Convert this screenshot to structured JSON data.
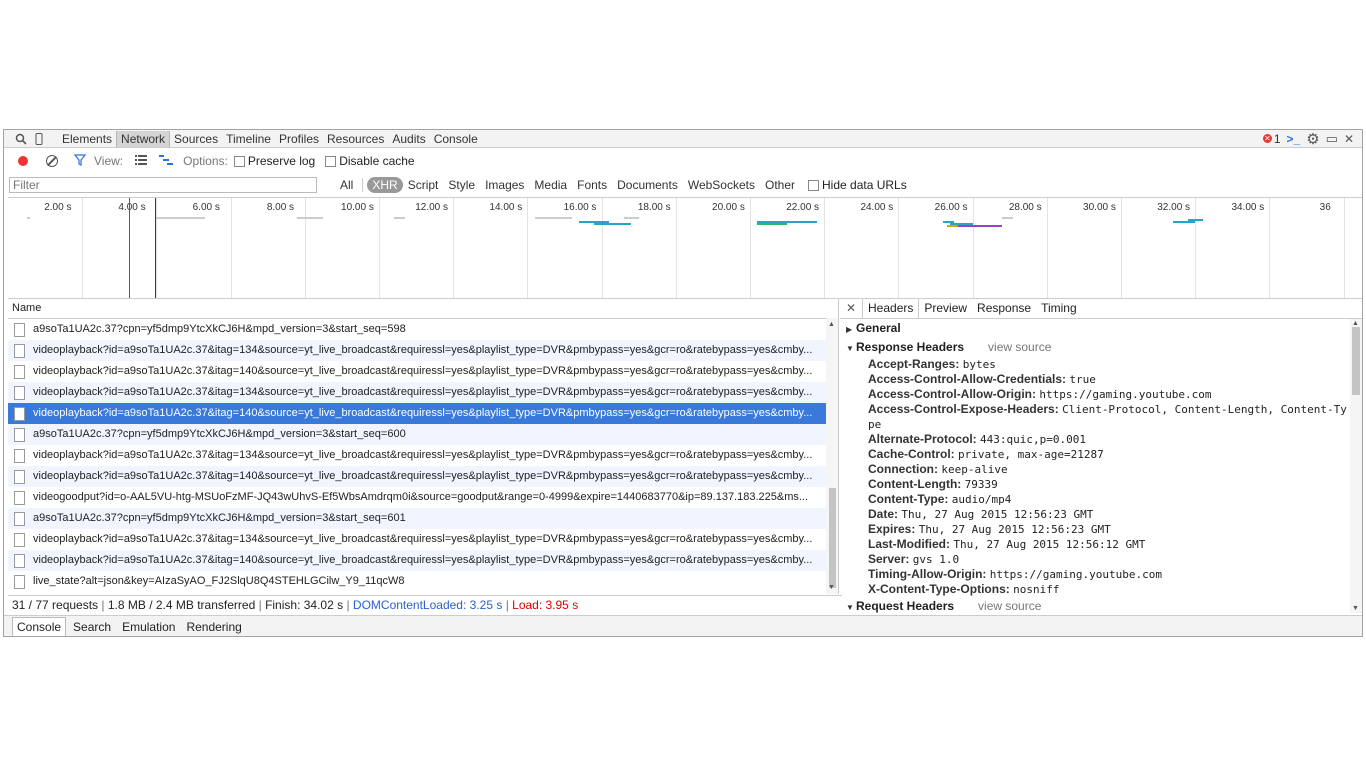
{
  "panels": [
    "Elements",
    "Network",
    "Sources",
    "Timeline",
    "Profiles",
    "Resources",
    "Audits",
    "Console"
  ],
  "selected_panel": "Network",
  "error_count": "1",
  "network_toolbar": {
    "view_label": "View:",
    "options_label": "Options:",
    "preserve_log_label": "Preserve log",
    "disable_cache_label": "Disable cache"
  },
  "filter": {
    "placeholder": "Filter",
    "value": ""
  },
  "type_filters": [
    "All",
    "XHR",
    "Script",
    "Style",
    "Images",
    "Media",
    "Fonts",
    "Documents",
    "WebSockets",
    "Other"
  ],
  "selected_type": "XHR",
  "hide_data_urls_label": "Hide data URLs",
  "overview_ticks": [
    "2.00 s",
    "4.00 s",
    "6.00 s",
    "8.00 s",
    "10.00 s",
    "12.00 s",
    "14.00 s",
    "16.00 s",
    "18.00 s",
    "20.00 s",
    "22.00 s",
    "24.00 s",
    "26.00 s",
    "28.00 s",
    "30.00 s",
    "32.00 s",
    "34.00 s",
    "36"
  ],
  "markers": {
    "dom_content_loaded_s": 3.25,
    "load_s": 3.95,
    "total_s": 36
  },
  "table": {
    "name_header": "Name",
    "requests": [
      "a9soTa1UA2c.37?cpn=yf5dmp9YtcXkCJ6H&mpd_version=3&start_seq=598",
      "videoplayback?id=a9soTa1UA2c.37&itag=134&source=yt_live_broadcast&requiressl=yes&playlist_type=DVR&pmbypass=yes&gcr=ro&ratebypass=yes&cmby...",
      "videoplayback?id=a9soTa1UA2c.37&itag=140&source=yt_live_broadcast&requiressl=yes&playlist_type=DVR&pmbypass=yes&gcr=ro&ratebypass=yes&cmby...",
      "videoplayback?id=a9soTa1UA2c.37&itag=134&source=yt_live_broadcast&requiressl=yes&playlist_type=DVR&pmbypass=yes&gcr=ro&ratebypass=yes&cmby...",
      "videoplayback?id=a9soTa1UA2c.37&itag=140&source=yt_live_broadcast&requiressl=yes&playlist_type=DVR&pmbypass=yes&gcr=ro&ratebypass=yes&cmby...",
      "a9soTa1UA2c.37?cpn=yf5dmp9YtcXkCJ6H&mpd_version=3&start_seq=600",
      "videoplayback?id=a9soTa1UA2c.37&itag=134&source=yt_live_broadcast&requiressl=yes&playlist_type=DVR&pmbypass=yes&gcr=ro&ratebypass=yes&cmby...",
      "videoplayback?id=a9soTa1UA2c.37&itag=140&source=yt_live_broadcast&requiressl=yes&playlist_type=DVR&pmbypass=yes&gcr=ro&ratebypass=yes&cmby...",
      "videogoodput?id=o-AAL5VU-htg-MSUoFzMF-JQ43wUhvS-Ef5WbsAmdrqm0i&source=goodput&range=0-4999&expire=1440683770&ip=89.137.183.225&ms...",
      "a9soTa1UA2c.37?cpn=yf5dmp9YtcXkCJ6H&mpd_version=3&start_seq=601",
      "videoplayback?id=a9soTa1UA2c.37&itag=134&source=yt_live_broadcast&requiressl=yes&playlist_type=DVR&pmbypass=yes&gcr=ro&ratebypass=yes&cmby...",
      "videoplayback?id=a9soTa1UA2c.37&itag=140&source=yt_live_broadcast&requiressl=yes&playlist_type=DVR&pmbypass=yes&gcr=ro&ratebypass=yes&cmby...",
      "live_state?alt=json&key=AIzaSyAO_FJ2SlqU8Q4STEHLGCilw_Y9_11qcW8"
    ],
    "selected_index": 4
  },
  "status": {
    "requests": "31 / 77 requests",
    "transferred": "1.8 MB / 2.4 MB transferred",
    "finish": "Finish: 34.02 s",
    "dom_content_loaded": "DOMContentLoaded: 3.25 s",
    "load": "Load: 3.95 s"
  },
  "details": {
    "tabs": [
      "Headers",
      "Preview",
      "Response",
      "Timing"
    ],
    "selected_tab": "Headers",
    "general_label": "General",
    "response_headers_label": "Response Headers",
    "request_headers_label": "Request Headers",
    "view_source_label": "view source",
    "response_headers": [
      {
        "name": "Accept-Ranges:",
        "value": "bytes"
      },
      {
        "name": "Access-Control-Allow-Credentials:",
        "value": "true"
      },
      {
        "name": "Access-Control-Allow-Origin:",
        "value": "https://gaming.youtube.com"
      },
      {
        "name": "Access-Control-Expose-Headers:",
        "value": "Client-Protocol, Content-Length, Content-Type"
      },
      {
        "name": "Alternate-Protocol:",
        "value": "443:quic,p=0.001"
      },
      {
        "name": "Cache-Control:",
        "value": "private, max-age=21287"
      },
      {
        "name": "Connection:",
        "value": "keep-alive"
      },
      {
        "name": "Content-Length:",
        "value": "79339"
      },
      {
        "name": "Content-Type:",
        "value": "audio/mp4"
      },
      {
        "name": "Date:",
        "value": "Thu, 27 Aug 2015 12:56:23 GMT"
      },
      {
        "name": "Expires:",
        "value": "Thu, 27 Aug 2015 12:56:23 GMT"
      },
      {
        "name": "Last-Modified:",
        "value": "Thu, 27 Aug 2015 12:56:12 GMT"
      },
      {
        "name": "Server:",
        "value": "gvs 1.0"
      },
      {
        "name": "Timing-Allow-Origin:",
        "value": "https://gaming.youtube.com"
      },
      {
        "name": "X-Content-Type-Options:",
        "value": "nosniff"
      }
    ]
  },
  "drawer_tabs": [
    "Console",
    "Search",
    "Emulation",
    "Rendering"
  ],
  "selected_drawer_tab": "Console",
  "colors": {
    "selected_row": "#3879d9",
    "record": "#e33333",
    "dcl_line": "#2a5fd0",
    "load_line": "#d00000",
    "bar_teal": "#25a6c5",
    "bar_green": "#2fb65e"
  }
}
